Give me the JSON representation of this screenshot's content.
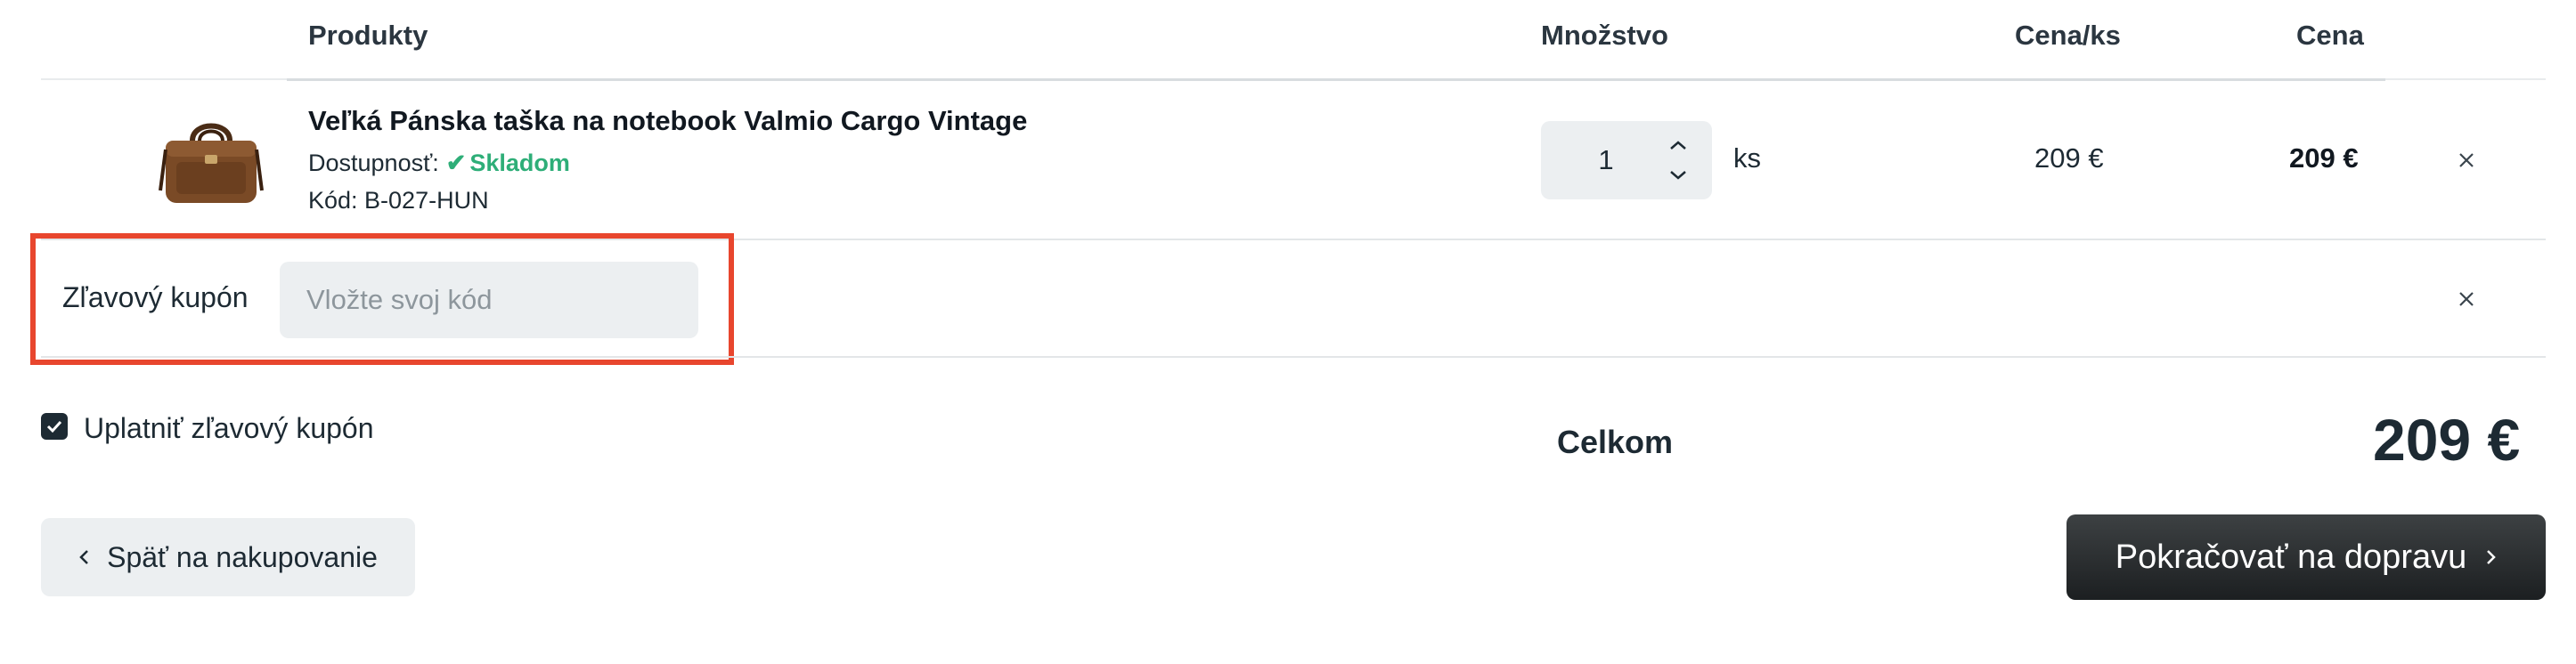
{
  "table": {
    "headers": {
      "products": "Produkty",
      "quantity": "Množstvo",
      "unit_price": "Cena/ks",
      "price": "Cena"
    }
  },
  "item": {
    "image_icon": "bag-product-image",
    "title": "Veľká Pánska taška na notebook Valmio Cargo Vintage",
    "availability_label": "Dostupnosť:",
    "availability_value": "Skladom",
    "code": "Kód: B-027-HUN",
    "quantity": "1",
    "unit": "ks",
    "unit_price": "209 €",
    "price": "209 €"
  },
  "coupon": {
    "label": "Zľavový kupón",
    "placeholder": "Vložte svoj kód",
    "value": ""
  },
  "apply_coupon": {
    "label": "Uplatniť zľavový kupón",
    "checked": true
  },
  "total": {
    "label": "Celkom",
    "value": "209 €"
  },
  "buttons": {
    "back": "Späť na nakupovanie",
    "continue": "Pokračovať na dopravu"
  },
  "colors": {
    "accent_green": "#2eae78",
    "highlight_frame": "#e8462e",
    "primary_button": "#1c1f21",
    "input_bg": "#eceff1"
  }
}
